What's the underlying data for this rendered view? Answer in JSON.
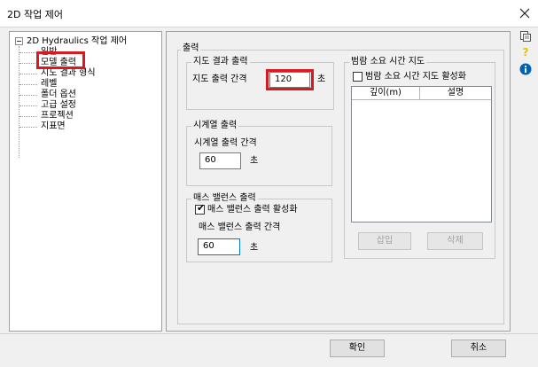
{
  "window": {
    "title": "2D 작업 제어"
  },
  "tree": {
    "root": "2D Hydraulics 작업 제어",
    "items": [
      "일반",
      "모델 출력",
      "지도 결과 형식",
      "레벨",
      "폴더 옵션",
      "고급 설정",
      "프로젝션",
      "지표면"
    ],
    "selected": "모델 출력"
  },
  "output": {
    "title": "출력",
    "map_results": {
      "title": "지도 결과 출력",
      "interval_label": "지도 출력 간격",
      "interval_value": "120",
      "unit": "초"
    },
    "timeseries": {
      "title": "시계열 출력",
      "interval_label": "시계열 출력 간격",
      "interval_value": "60",
      "unit": "초"
    },
    "mass_balance": {
      "title": "매스 밸런스 출력",
      "enable_label": "매스 밸런스 출력 활성화",
      "enable_checked": true,
      "interval_label": "매스 밸런스 출력 간격",
      "interval_value": "60",
      "unit": "초"
    },
    "inundation": {
      "title": "범람 소요 시간 지도",
      "enable_label": "범람 소요 시간 지도 활성화",
      "enable_checked": false,
      "columns": [
        "깊이(m)",
        "설명"
      ],
      "insert_label": "삽입",
      "delete_label": "삭제"
    }
  },
  "footer": {
    "ok_label": "확인",
    "cancel_label": "취소"
  },
  "sidebar_icons": [
    "copy-icon",
    "help-icon",
    "info-icon"
  ],
  "colors": {
    "highlight": "#d71920",
    "info": "#0063b1",
    "help": "#e8c000"
  }
}
